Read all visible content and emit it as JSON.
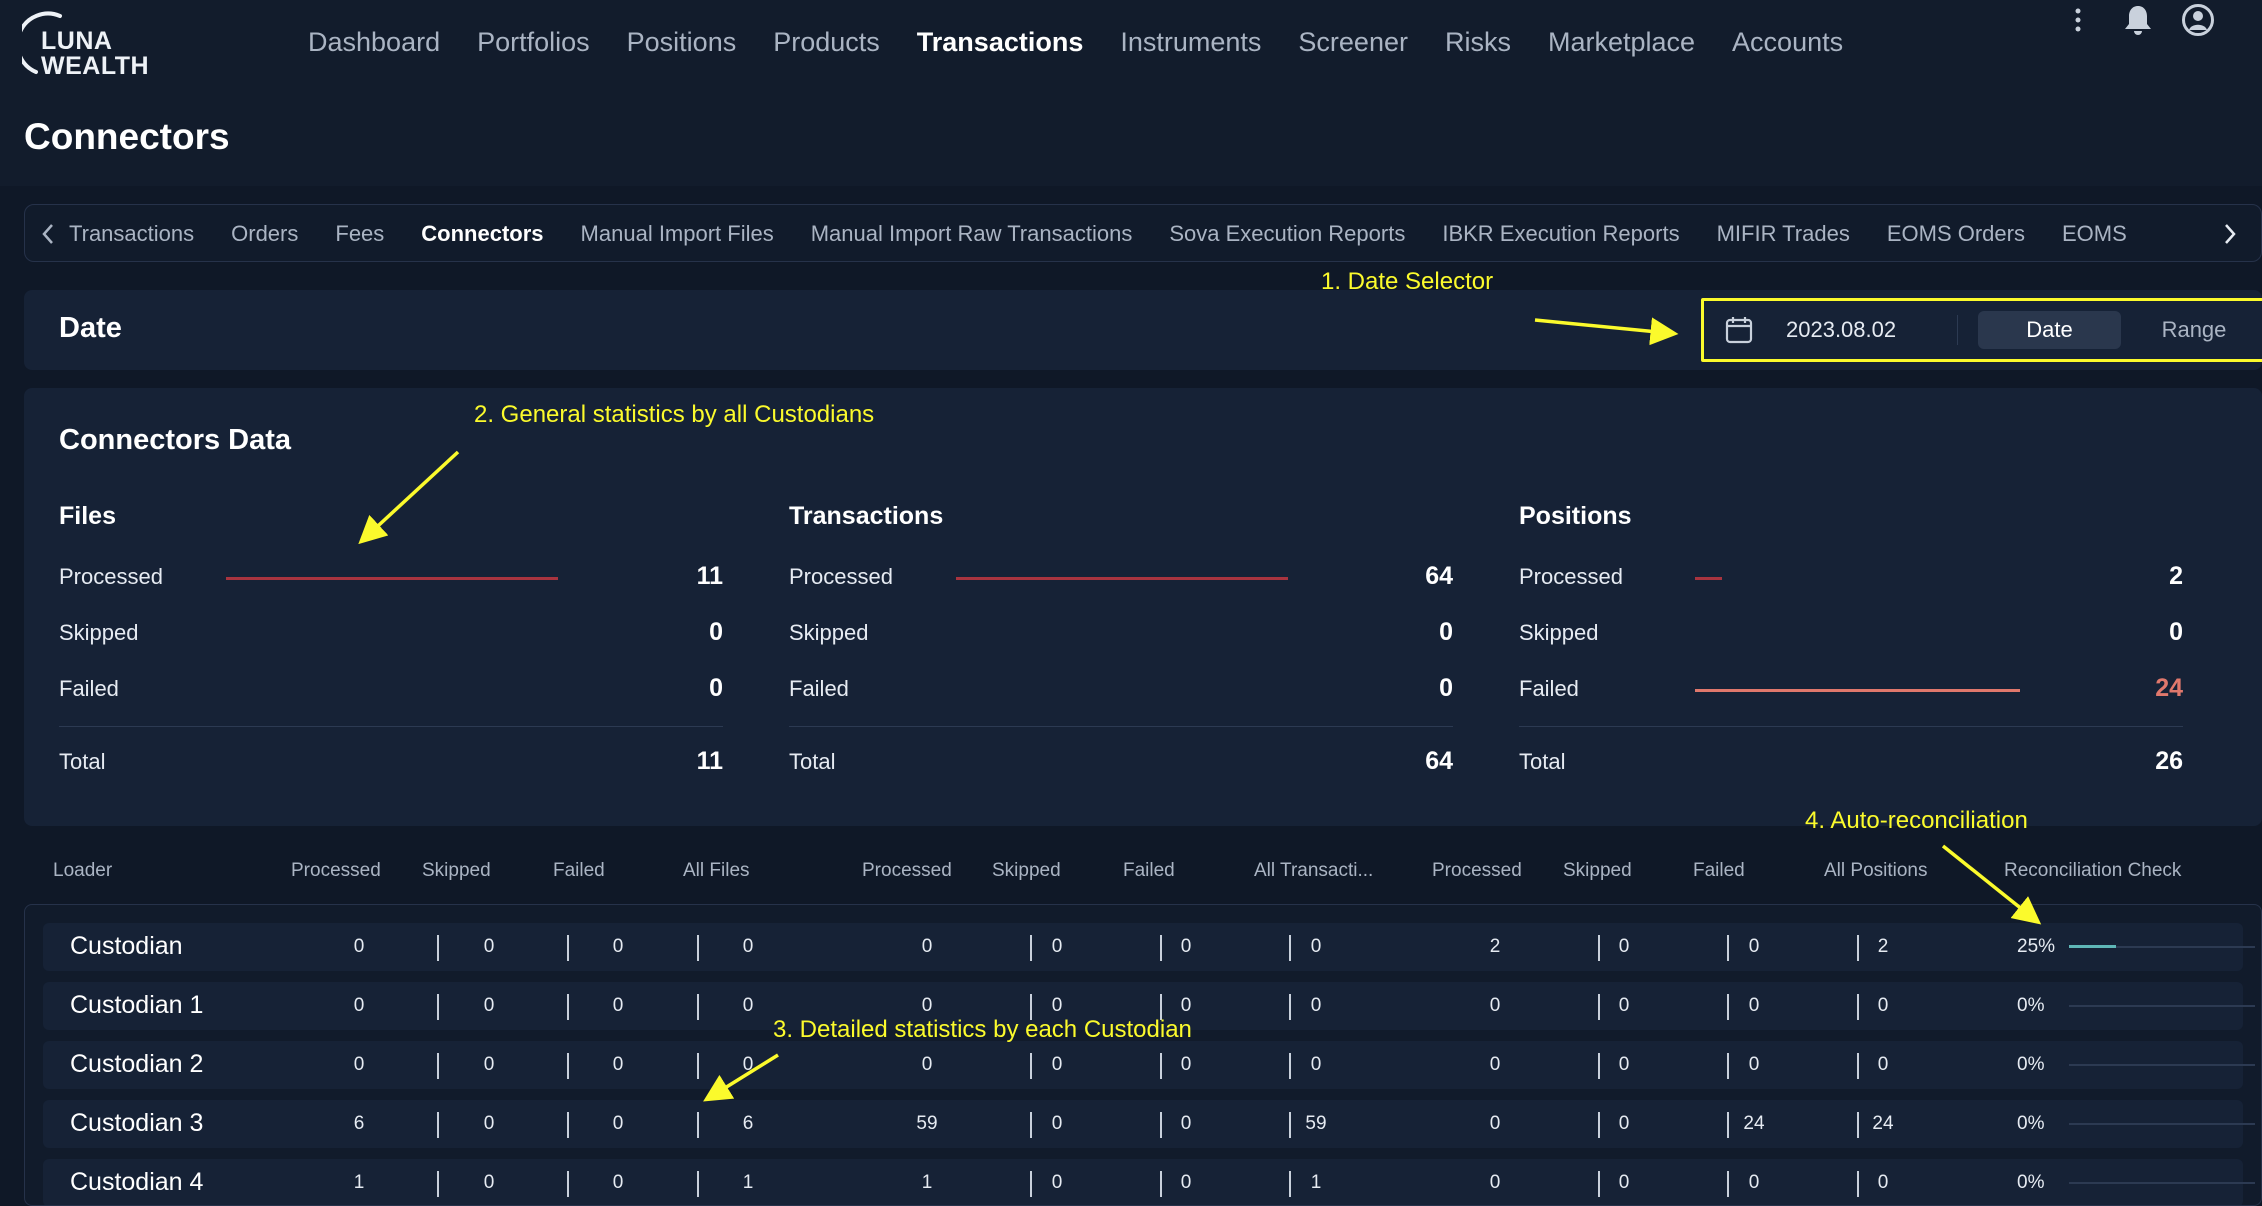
{
  "logo": {
    "line1": "LUNA",
    "line2": "WEALTH"
  },
  "nav": {
    "items": [
      {
        "label": "Dashboard"
      },
      {
        "label": "Portfolios"
      },
      {
        "label": "Positions"
      },
      {
        "label": "Products"
      },
      {
        "label": "Transactions",
        "active": true
      },
      {
        "label": "Instruments"
      },
      {
        "label": "Screener"
      },
      {
        "label": "Risks"
      },
      {
        "label": "Marketplace"
      },
      {
        "label": "Accounts"
      }
    ],
    "icons": [
      "more-vertical-icon",
      "bell-icon",
      "user-icon"
    ]
  },
  "page": {
    "title": "Connectors"
  },
  "tabs": {
    "items": [
      {
        "label": "Transactions"
      },
      {
        "label": "Orders"
      },
      {
        "label": "Fees"
      },
      {
        "label": "Connectors",
        "active": true
      },
      {
        "label": "Manual Import Files"
      },
      {
        "label": "Manual Import Raw Transactions"
      },
      {
        "label": "Sova Execution Reports"
      },
      {
        "label": "IBKR Execution Reports"
      },
      {
        "label": "MIFIR Trades"
      },
      {
        "label": "EOMS Orders"
      },
      {
        "label": "EOMS"
      }
    ]
  },
  "date_card": {
    "label": "Date",
    "value": "2023.08.02",
    "mode_date": "Date",
    "mode_range": "Range",
    "selected_mode": "Date"
  },
  "connectors_data": {
    "title": "Connectors Data",
    "groups": [
      {
        "title": "Files",
        "rows": [
          {
            "label": "Processed",
            "value": "11"
          },
          {
            "label": "Skipped",
            "value": "0"
          },
          {
            "label": "Failed",
            "value": "0"
          }
        ],
        "total_label": "Total",
        "total": "11"
      },
      {
        "title": "Transactions",
        "rows": [
          {
            "label": "Processed",
            "value": "64"
          },
          {
            "label": "Skipped",
            "value": "0"
          },
          {
            "label": "Failed",
            "value": "0"
          }
        ],
        "total_label": "Total",
        "total": "64"
      },
      {
        "title": "Positions",
        "rows": [
          {
            "label": "Processed",
            "value": "2"
          },
          {
            "label": "Skipped",
            "value": "0"
          },
          {
            "label": "Failed",
            "value": "24"
          }
        ],
        "total_label": "Total",
        "total": "26"
      }
    ]
  },
  "table": {
    "headers": [
      "Loader",
      "Processed",
      "Skipped",
      "Failed",
      "All Files",
      "Processed",
      "Skipped",
      "Failed",
      "All Transacti...",
      "Processed",
      "Skipped",
      "Failed",
      "All Positions",
      "Reconciliation Check"
    ],
    "rows": [
      {
        "name": "Custodian",
        "values": [
          "0",
          "0",
          "0",
          "0",
          "0",
          "0",
          "0",
          "0",
          "2",
          "0",
          "0",
          "2"
        ],
        "recon": "25%",
        "recon_fraction": 0.25
      },
      {
        "name": "Custodian 1",
        "values": [
          "0",
          "0",
          "0",
          "0",
          "0",
          "0",
          "0",
          "0",
          "0",
          "0",
          "0",
          "0"
        ],
        "recon": "0%",
        "recon_fraction": 0
      },
      {
        "name": "Custodian 2",
        "values": [
          "0",
          "0",
          "0",
          "0",
          "0",
          "0",
          "0",
          "0",
          "0",
          "0",
          "0",
          "0"
        ],
        "recon": "0%",
        "recon_fraction": 0
      },
      {
        "name": "Custodian 3",
        "values": [
          "6",
          "0",
          "0",
          "6",
          "59",
          "0",
          "0",
          "59",
          "0",
          "0",
          "24",
          "24"
        ],
        "recon": "0%",
        "recon_fraction": 0
      },
      {
        "name": "Custodian 4",
        "values": [
          "1",
          "0",
          "0",
          "1",
          "1",
          "0",
          "0",
          "1",
          "0",
          "0",
          "0",
          "0"
        ],
        "recon": "0%",
        "recon_fraction": 0
      }
    ]
  },
  "annotations": {
    "a1": "1. Date Selector",
    "a2": "2. General statistics by all Custodians",
    "a3": "3. Detailed statistics by each Custodian",
    "a4": "4. Auto-reconciliation"
  },
  "colors": {
    "background": "#121c2c",
    "card": "#162236",
    "accent_bar": "#a8343f",
    "warn": "#e0786c",
    "recon": "#5fb7b7",
    "annotation": "#fbfa2c"
  }
}
